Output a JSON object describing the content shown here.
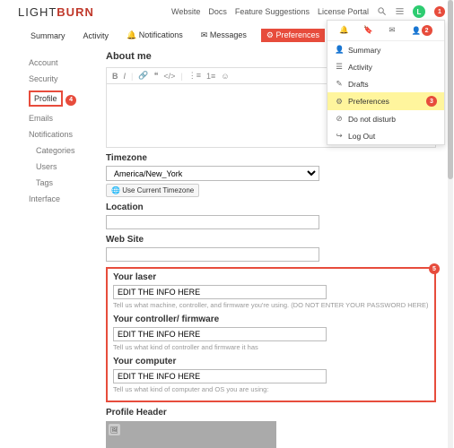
{
  "logo": {
    "part1": "LIGHT",
    "part2": "BURN"
  },
  "topnav": {
    "website": "Website",
    "docs": "Docs",
    "feature": "Feature Suggestions",
    "license": "License Portal"
  },
  "markers": {
    "m1": "1",
    "m2": "2",
    "m3": "3",
    "m4": "4",
    "m5": "5"
  },
  "tabs": {
    "summary": "Summary",
    "activity": "Activity",
    "notifications": "Notifications",
    "messages": "Messages",
    "preferences": "Preferences"
  },
  "sidebar": {
    "account": "Account",
    "security": "Security",
    "profile": "Profile",
    "emails": "Emails",
    "notifications": "Notifications",
    "categories": "Categories",
    "users": "Users",
    "tags": "Tags",
    "interface": "Interface"
  },
  "about": {
    "heading": "About me"
  },
  "timezone": {
    "label": "Timezone",
    "value": "America/New_York",
    "btn": "Use Current Timezone"
  },
  "location": {
    "label": "Location"
  },
  "website": {
    "label": "Web Site"
  },
  "laser": {
    "label": "Your laser",
    "value": "EDIT THE INFO HERE",
    "hint": "Tell us what machine, controller, and firmware you're using. (DO NOT ENTER YOUR PASSWORD HERE)"
  },
  "controller": {
    "label": "Your controller/ firmware",
    "value": "EDIT THE INFO HERE",
    "hint": "Tell us what kind of controller and firmware it has"
  },
  "computer": {
    "label": "Your computer",
    "value": "EDIT THE INFO HERE",
    "hint": "Tell us what kind of computer and OS you are using:"
  },
  "profileHeader": {
    "label": "Profile Header"
  },
  "dropdown": {
    "summary": "Summary",
    "activity": "Activity",
    "drafts": "Drafts",
    "preferences": "Preferences",
    "dnd": "Do not disturb",
    "logout": "Log Out"
  },
  "avatar_letter": "L"
}
